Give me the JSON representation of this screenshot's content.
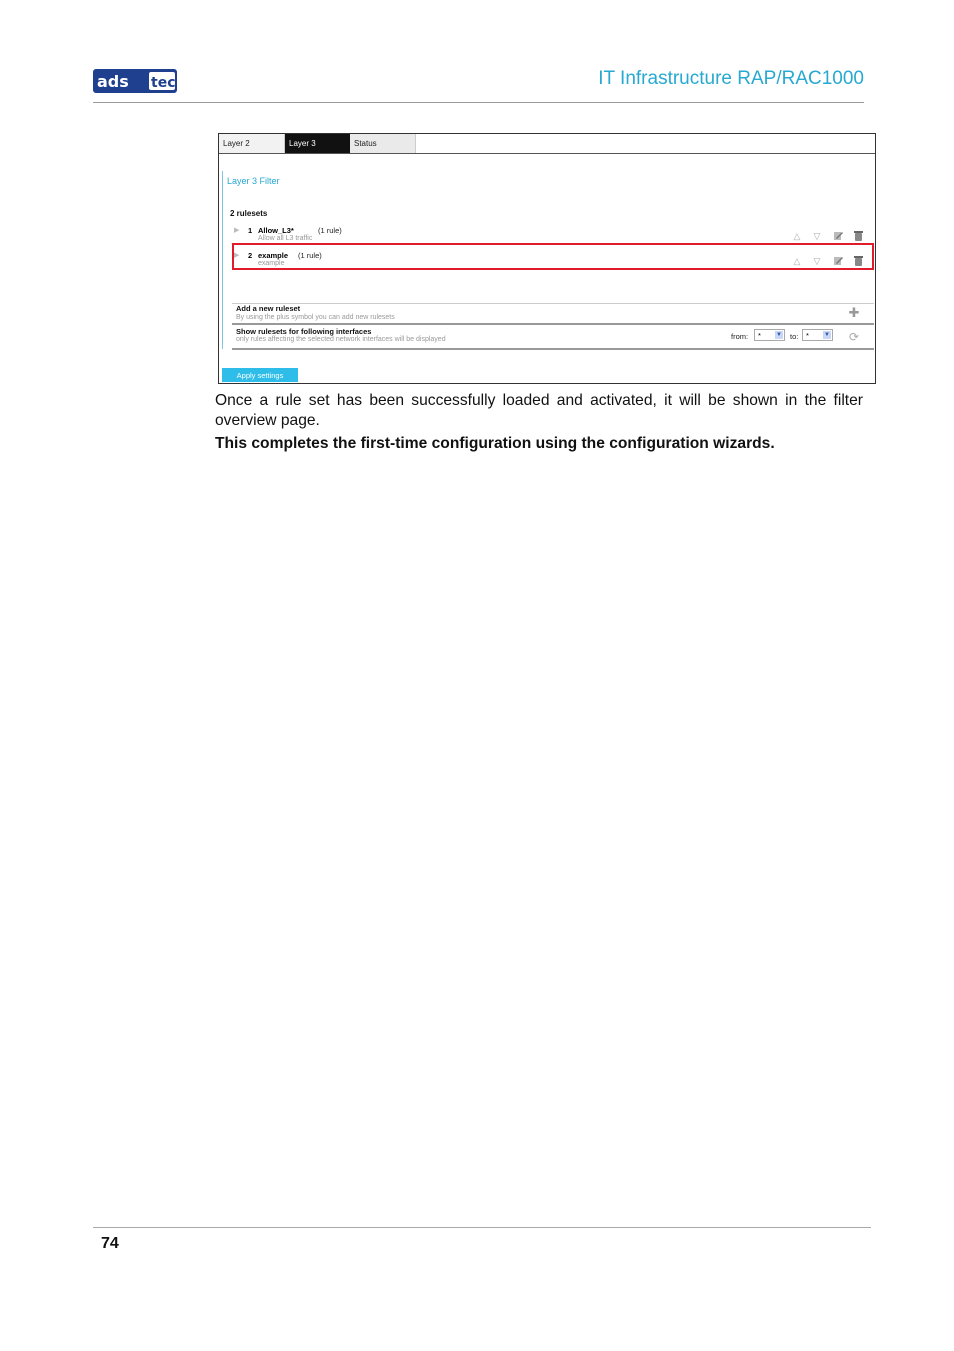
{
  "header": {
    "logo_text": "adstec",
    "title": "IT Infrastructure RAP/RAC1000",
    "colors": {
      "logo_blue": "#1f3f8f",
      "title_cyan": "#27a9d1"
    }
  },
  "screenshot": {
    "tabs": [
      {
        "label": "Layer 2",
        "active": false
      },
      {
        "label": "Layer 3",
        "active": true
      },
      {
        "label": "Status",
        "active": false
      }
    ],
    "section_title": "Layer 3 Filter",
    "ruleset_count": "2 rulesets",
    "rulesets": [
      {
        "index": "1",
        "name": "Allow_L3*",
        "rules": "(1 rule)",
        "description": "Allow all L3 traffic",
        "highlighted": false
      },
      {
        "index": "2",
        "name": "example",
        "rules": "(1 rule)",
        "description": "example",
        "highlighted": true
      }
    ],
    "row_icons": [
      "move-up-icon",
      "move-down-icon",
      "edit-icon",
      "delete-icon"
    ],
    "add_ruleset": {
      "title": "Add a new ruleset",
      "subtitle": "By using the plus symbol you can add new rulesets"
    },
    "show_rulesets": {
      "title": "Show rulesets for following interfaces",
      "subtitle": "only rules affecting the selected network interfaces will be displayed",
      "from_label": "from:",
      "from_value": "*",
      "to_label": "to:",
      "to_value": "*"
    },
    "apply_button": "Apply settings",
    "highlight_color": "#e01b2b"
  },
  "body": {
    "paragraph": "Once a rule set has been successfully loaded and activated, it will be shown in the filter overview page.",
    "bold_line": "This completes the first-time configuration using the configuration wizards."
  },
  "footer": {
    "page_number": "74"
  }
}
